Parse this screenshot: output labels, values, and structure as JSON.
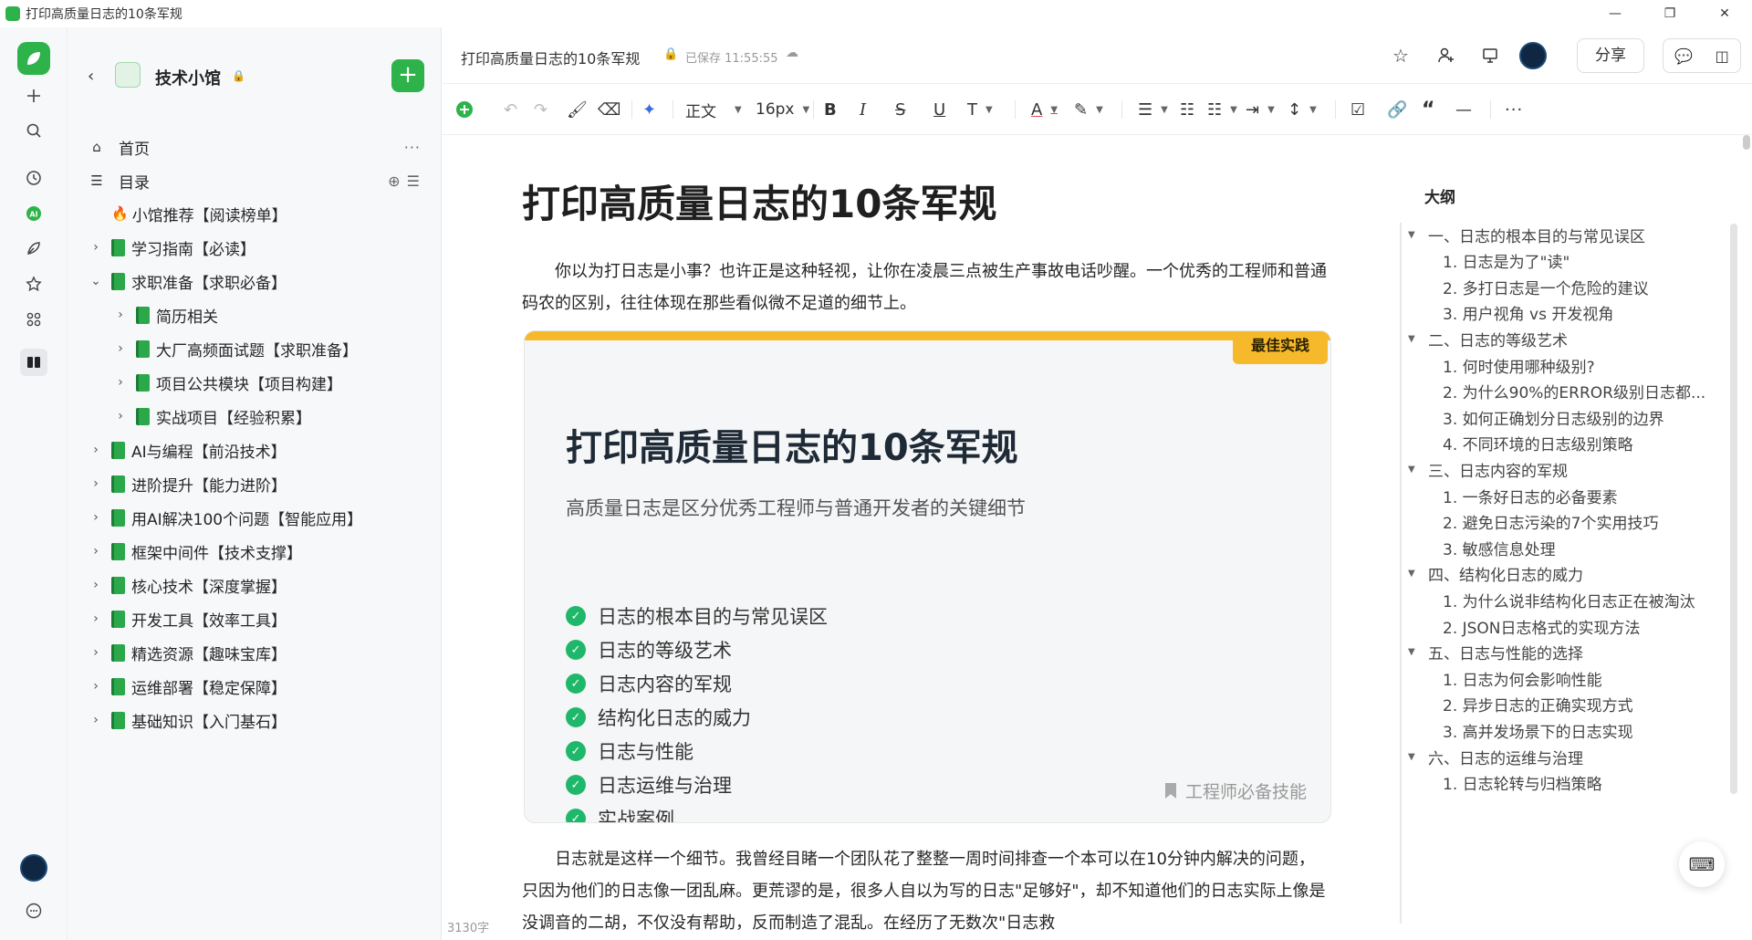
{
  "window": {
    "title": "打印高质量日志的10条军规",
    "controls": [
      "—",
      "❐",
      "✕"
    ]
  },
  "rail": {
    "icons": [
      "add-icon",
      "search-icon",
      "clock-icon",
      "ai-icon",
      "pen-icon",
      "star-icon",
      "apps-icon",
      "book-icon"
    ]
  },
  "sidebar": {
    "book_title": "技术小馆",
    "nav": [
      {
        "label": "首页",
        "icon": "home-icon",
        "right": "···"
      },
      {
        "label": "目录",
        "icon": "toc-icon",
        "right": "⊕ ☰"
      }
    ],
    "tree": [
      {
        "label": "小馆推荐【阅读榜单】",
        "level": 0,
        "chevron": "",
        "icon": "fire"
      },
      {
        "label": "学习指南【必读】",
        "level": 0,
        "chevron": "›",
        "icon": "doc"
      },
      {
        "label": "求职准备【求职必备】",
        "level": 0,
        "chevron": "⌄",
        "icon": "doc"
      },
      {
        "label": "简历相关",
        "level": 1,
        "chevron": "›",
        "icon": "doc"
      },
      {
        "label": "大厂高频面试题【求职准备】",
        "level": 1,
        "chevron": "›",
        "icon": "doc"
      },
      {
        "label": "项目公共模块【项目构建】",
        "level": 1,
        "chevron": "›",
        "icon": "doc"
      },
      {
        "label": "实战项目【经验积累】",
        "level": 1,
        "chevron": "›",
        "icon": "doc"
      },
      {
        "label": "AI与编程【前沿技术】",
        "level": 0,
        "chevron": "›",
        "icon": "doc"
      },
      {
        "label": "进阶提升【能力进阶】",
        "level": 0,
        "chevron": "›",
        "icon": "doc"
      },
      {
        "label": "用AI解决100个问题【智能应用】",
        "level": 0,
        "chevron": "›",
        "icon": "doc"
      },
      {
        "label": "框架中间件【技术支撑】",
        "level": 0,
        "chevron": "›",
        "icon": "doc"
      },
      {
        "label": "核心技术【深度掌握】",
        "level": 0,
        "chevron": "›",
        "icon": "doc"
      },
      {
        "label": "开发工具【效率工具】",
        "level": 0,
        "chevron": "›",
        "icon": "doc"
      },
      {
        "label": "精选资源【趣味宝库】",
        "level": 0,
        "chevron": "›",
        "icon": "doc"
      },
      {
        "label": "运维部署【稳定保障】",
        "level": 0,
        "chevron": "›",
        "icon": "doc"
      },
      {
        "label": "基础知识【入门基石】",
        "level": 0,
        "chevron": "›",
        "icon": "doc"
      }
    ]
  },
  "header": {
    "doc_title": "打印高质量日志的10条军规",
    "saved": "已保存 11:55:55",
    "share": "分享"
  },
  "toolbar": {
    "style": "正文",
    "font_size": "16px"
  },
  "doc": {
    "title": "打印高质量日志的10条军规",
    "intro": "你以为打日志是小事？也许正是这种轻视，让你在凌晨三点被生产事故电话吵醒。一个优秀的工程师和普通码农的区别，往往体现在那些看似微不足道的细节上。",
    "card": {
      "badge": "最佳实践",
      "title": "打印高质量日志的10条军规",
      "subtitle": "高质量日志是区分优秀工程师与普通开发者的关键细节",
      "items": [
        "日志的根本目的与常见误区",
        "日志的等级艺术",
        "日志内容的军规",
        "结构化日志的威力",
        "日志与性能",
        "日志运维与治理",
        "实战案例"
      ],
      "footer": "工程师必备技能"
    },
    "para2": "日志就是这样一个细节。我曾经目睹一个团队花了整整一周时间排查一个本可以在10分钟内解决的问题，只因为他们的日志像一团乱麻。更荒谬的是，很多人自以为写的日志\"足够好\"，却不知道他们的日志实际上像是没调音的二胡，不仅没有帮助，反而制造了混乱。在经历了无数次\"日志救",
    "word_count": "3130字"
  },
  "outline": {
    "title": "大纲",
    "items": [
      {
        "label": "一、日志的根本目的与常见误区",
        "level": 0
      },
      {
        "label": "1. 日志是为了\"读\"",
        "level": 1
      },
      {
        "label": "2. 多打日志是一个危险的建议",
        "level": 1
      },
      {
        "label": "3. 用户视角 vs 开发视角",
        "level": 1
      },
      {
        "label": "二、日志的等级艺术",
        "level": 0
      },
      {
        "label": "1. 何时使用哪种级别?",
        "level": 1
      },
      {
        "label": "2. 为什么90%的ERROR级别日志都...",
        "level": 1
      },
      {
        "label": "3. 如何正确划分日志级别的边界",
        "level": 1
      },
      {
        "label": "4. 不同环境的日志级别策略",
        "level": 1
      },
      {
        "label": "三、日志内容的军规",
        "level": 0
      },
      {
        "label": "1. 一条好日志的必备要素",
        "level": 1
      },
      {
        "label": "2. 避免日志污染的7个实用技巧",
        "level": 1
      },
      {
        "label": "3. 敏感信息处理",
        "level": 1
      },
      {
        "label": "四、结构化日志的威力",
        "level": 0
      },
      {
        "label": "1. 为什么说非结构化日志正在被淘汰",
        "level": 1
      },
      {
        "label": "2. JSON日志格式的实现方法",
        "level": 1
      },
      {
        "label": "五、日志与性能的选择",
        "level": 0
      },
      {
        "label": "1. 日志为何会影响性能",
        "level": 1
      },
      {
        "label": "2. 异步日志的正确实现方式",
        "level": 1
      },
      {
        "label": "3. 高并发场景下的日志实现",
        "level": 1
      },
      {
        "label": "六、日志的运维与治理",
        "level": 0
      },
      {
        "label": "1. 日志轮转与归档策略",
        "level": 1
      }
    ]
  },
  "colors": {
    "brand": "#2db34a",
    "badge": "#f6b92b",
    "check": "#1fb86a"
  }
}
